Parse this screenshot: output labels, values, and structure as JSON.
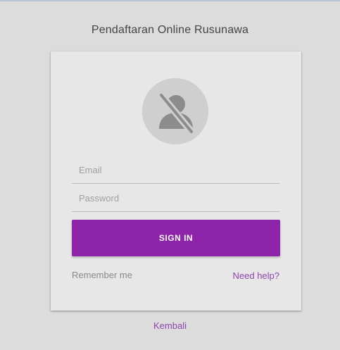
{
  "page": {
    "title": "Pendaftaran Online Rusunawa"
  },
  "login": {
    "avatar_icon": "user-off-icon",
    "email_placeholder": "Email",
    "email_value": "",
    "password_placeholder": "Password",
    "password_value": "",
    "signin_label": "SIGN IN",
    "remember_label": "Remember me",
    "help_label": "Need help?"
  },
  "footer": {
    "back_label": "Kembali"
  },
  "colors": {
    "accent": "#8e24aa",
    "link": "#8e44ad",
    "background": "#dcdcdc",
    "card": "#e7e7e7"
  }
}
